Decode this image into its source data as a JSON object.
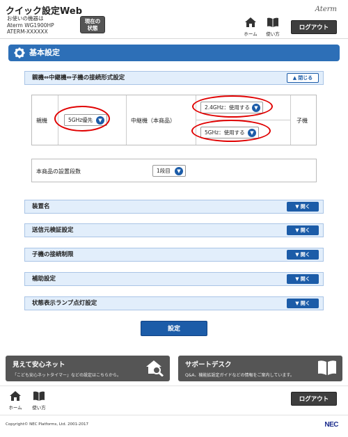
{
  "header": {
    "app_title": "クイック設定Web",
    "device_label": "お使いの機器は",
    "device_model": "Aterm WG1900HP",
    "device_name": "ATERM-XXXXXX",
    "status_button_line1": "現在の",
    "status_button_line2": "状態",
    "brand": "Aterm",
    "home_label": "ホーム",
    "manual_label": "使い方",
    "logout_label": "ログアウト"
  },
  "section": {
    "title": "基本設定"
  },
  "connection_panel": {
    "title": "親機⇔中継機⇔子機の接続形式設定",
    "toggle_label": "閉じる",
    "parent_label": "親機",
    "parent_select": "5GHz優先",
    "repeater_label": "中継機（本商品）",
    "repeater_24_select": "2.4GHz：使用する",
    "repeater_5_select": "5GHz：使用する",
    "child_label": "子機"
  },
  "stage": {
    "label": "本商品の設置段数",
    "select": "1段目"
  },
  "panels": [
    {
      "title": "装置名",
      "toggle_label": "開く"
    },
    {
      "title": "送信元検証設定",
      "toggle_label": "開く"
    },
    {
      "title": "子機の接続制限",
      "toggle_label": "開く"
    },
    {
      "title": "補助設定",
      "toggle_label": "開く"
    },
    {
      "title": "状態表示ランプ点灯設定",
      "toggle_label": "開く"
    }
  ],
  "submit_label": "設定",
  "cards": [
    {
      "title": "見えて安心ネット",
      "desc": "「こども安心ネットタイマー」などの設定はこちらから。",
      "icon": "house-search-icon"
    },
    {
      "title": "サポートデスク",
      "desc": "Q&A、機能拡設定ガイドなどの情報をご案内しています。",
      "icon": "book-icon"
    }
  ],
  "footer": {
    "home_label": "ホーム",
    "manual_label": "使い方",
    "logout_label": "ログアウト",
    "copyright": "Copyright© NEC Platforms, Ltd. 2001-2017",
    "logo": "NEC"
  },
  "colors": {
    "accent": "#2d6fb7",
    "button": "#1c5ca8",
    "panel_bg": "#e2eefb",
    "highlight": "#e00000",
    "dark": "#3e3e3e"
  }
}
